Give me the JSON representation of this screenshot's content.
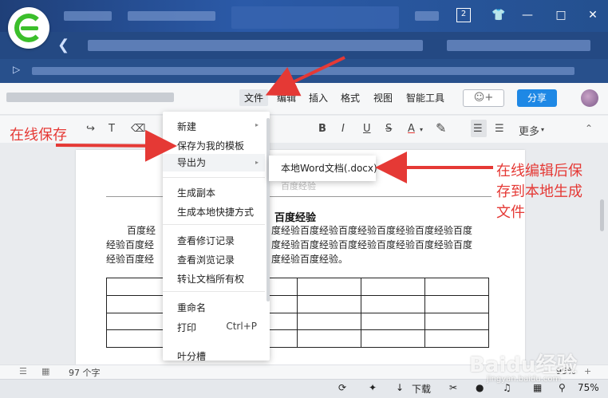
{
  "window": {
    "tab_count": "2"
  },
  "menubar": {
    "items": [
      "文件",
      "编辑",
      "插入",
      "格式",
      "视图",
      "智能工具"
    ],
    "share_label": "分享",
    "user_icon": "user-plus-icon"
  },
  "formatbar": {
    "bold": "B",
    "italic": "I",
    "underline": "U",
    "strike": "S",
    "color": "A",
    "more": "更多"
  },
  "file_menu": {
    "items": [
      "新建",
      "保存为我的模板",
      "导出为",
      "生成副本",
      "生成本地快捷方式",
      "查看修订记录",
      "查看浏览记录",
      "转让文档所有权",
      "重命名",
      "打印",
      "叶分槽"
    ],
    "print_shortcut": "Ctrl+P"
  },
  "export_submenu": {
    "item": "本地Word文档(.docx)"
  },
  "document": {
    "header_text": "百度经验",
    "title": "百度经验",
    "para_left_line1": "百度经",
    "para_left_line2": "经验百度经",
    "para_left_line3": "经验百度经",
    "para_right_line1": "度经验百度经验百度经验百度经验百度经验百度",
    "para_right_line2": "度经验百度经验百度经验百度经验百度经验百度",
    "para_right_line3": "度经验百度经验。",
    "table_rows": 4,
    "table_cols": 6
  },
  "status": {
    "word_count": "97 个字",
    "zoom": "95%"
  },
  "taskbar": {
    "download": "下载",
    "battery": "75%"
  },
  "annotations": {
    "left": "在线保存",
    "right_line1": "在线编辑后保",
    "right_line2": "存到本地生成",
    "right_line3": "文件",
    "color": "#e53935"
  },
  "watermark": {
    "brand": "Baidu经验",
    "url": "jingyan.baidu.com"
  }
}
